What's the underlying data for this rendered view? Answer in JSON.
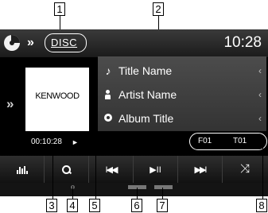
{
  "callouts": {
    "c1": "1",
    "c2": "2",
    "c3": "3",
    "c4": "4",
    "c5": "5",
    "c6": "6",
    "c7": "7",
    "c8": "8"
  },
  "topbar": {
    "source_label": "DISC",
    "source_icon": "disc-icon",
    "expand_icon": "double-chevron-right-icon",
    "clock": "10:28"
  },
  "sidebar": {
    "expand_icon": "double-chevron-right-icon"
  },
  "artwork": {
    "text": "KENWOOD"
  },
  "track_info": [
    {
      "icon": "note-icon",
      "label": "Title Name"
    },
    {
      "icon": "person-icon",
      "label": "Artist Name"
    },
    {
      "icon": "disc-icon",
      "label": "Album Title"
    }
  ],
  "playback": {
    "elapsed": "00:10:28",
    "state_icon": "play-indicator-icon",
    "folder": "F01",
    "track": "T01"
  },
  "controls": [
    {
      "name": "equalizer-button",
      "icon": "equalizer-icon"
    },
    {
      "name": "search-button",
      "icon": "search-icon"
    },
    {
      "name": "previous-button",
      "glyph": "⏮"
    },
    {
      "name": "play-pause-button",
      "glyph": "►ll"
    },
    {
      "name": "next-button",
      "glyph": "⏭"
    },
    {
      "name": "shuffle-button",
      "glyph": "⤨"
    }
  ],
  "colors": {
    "screen_bg": "#000000",
    "panel_bg": "#444444",
    "text": "#ffffff"
  }
}
